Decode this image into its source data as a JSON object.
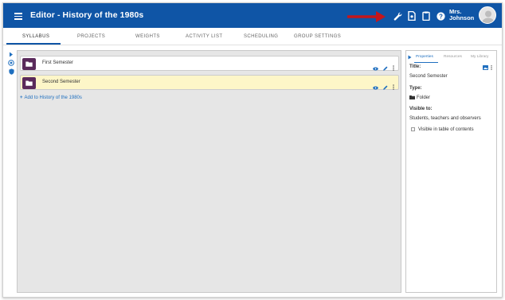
{
  "header": {
    "title": "Editor - History of the 1980s",
    "user_first": "Mrs.",
    "user_last": "Johnson",
    "icons": [
      "menu-icon",
      "wrench-icon",
      "document-icon",
      "clipboard-icon",
      "help-icon",
      "avatar"
    ],
    "accent_color": "#0f55a6",
    "annotation_arrow_color": "#c4161c"
  },
  "tabs": [
    {
      "label": "SYLLABUS",
      "active": true
    },
    {
      "label": "PROJECTS"
    },
    {
      "label": "WEIGHTS"
    },
    {
      "label": "ACTIVITY LIST"
    },
    {
      "label": "SCHEDULING"
    },
    {
      "label": "GROUP SETTINGS"
    }
  ],
  "syllabus": {
    "items": [
      {
        "label": "First Semester",
        "icon": "folder-icon",
        "selected": false
      },
      {
        "label": "Second Semester",
        "icon": "folder-icon",
        "selected": true,
        "highlight_color": "#fdf6c8"
      }
    ],
    "add_link": "Add to History of the 1980s"
  },
  "properties_panel": {
    "tabs": [
      "Properties",
      "Resources",
      "My Library"
    ],
    "title_label": "Title:",
    "title_value": "Second Semester",
    "type_label": "Type:",
    "type_value": "Folder",
    "visible_label": "Visible to:",
    "visible_value": "Students, teachers and observers",
    "toc_label": "Visible in table of contents",
    "toc_checked": false
  }
}
